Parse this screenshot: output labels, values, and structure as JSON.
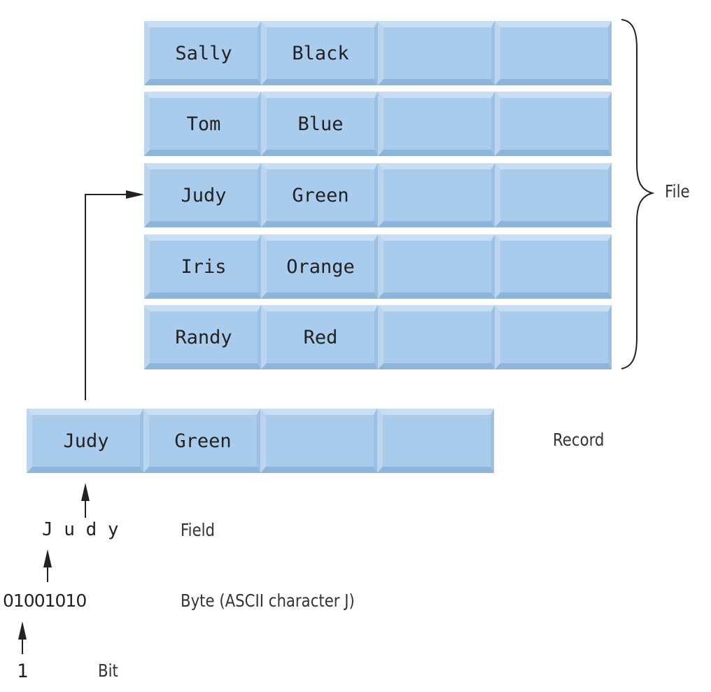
{
  "file": {
    "label": "File",
    "records": [
      [
        "Sally",
        "Black",
        "",
        ""
      ],
      [
        "Tom",
        "Blue",
        "",
        ""
      ],
      [
        "Judy",
        "Green",
        "",
        ""
      ],
      [
        "Iris",
        "Orange",
        "",
        ""
      ],
      [
        "Randy",
        "Red",
        "",
        ""
      ]
    ]
  },
  "record": {
    "label": "Record",
    "fields": [
      "Judy",
      "Green",
      "",
      ""
    ]
  },
  "field": {
    "label": "Field",
    "value": "J u d y"
  },
  "byte": {
    "label": "Byte (ASCII character J)",
    "value": "01001010"
  },
  "bit": {
    "label": "Bit",
    "value": "1"
  },
  "colors": {
    "cell_face": "#a9cbec",
    "cell_light": "#c9def3",
    "cell_dark": "#8db4da"
  }
}
